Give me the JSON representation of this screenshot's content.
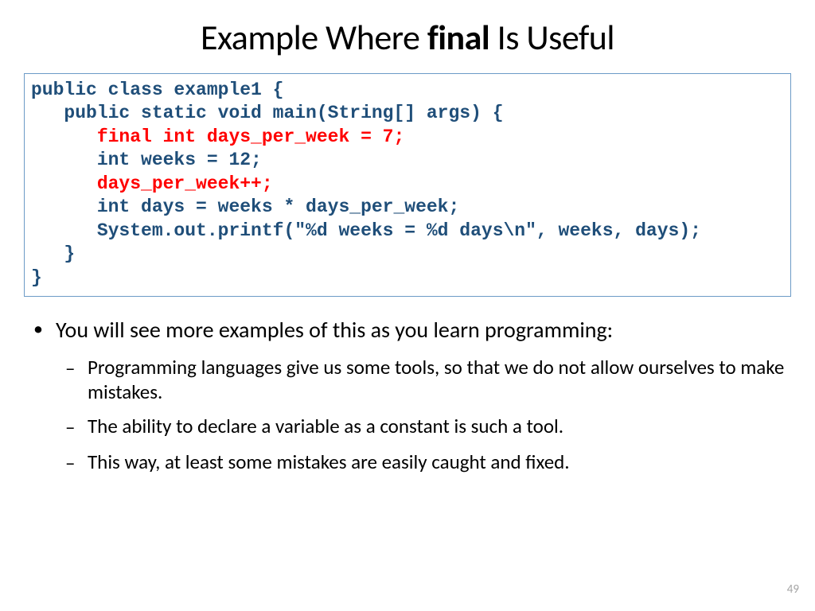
{
  "title": {
    "pre": "Example Where ",
    "bold": "final",
    "post": " Is Useful"
  },
  "code": {
    "l1": "public class example1 {",
    "l2": "   public static void main(String[] args) {",
    "l3": "      final int days_per_week = 7;",
    "l4": "      int weeks = 12;",
    "l5": "      days_per_week++;",
    "l6": "      int days = weeks * days_per_week;",
    "l7": "      System.out.printf(\"%d weeks = %d days\\n\", weeks, days);",
    "l8": "   }",
    "l9": "}"
  },
  "bullets": {
    "main": "You will see more examples of this as you learn programming:",
    "sub1": "Programming languages give us some tools, so that we do not allow ourselves to make mistakes.",
    "sub2": "The ability to declare a variable as a constant is such a tool.",
    "sub3": "This way, at least some mistakes are easily caught and fixed."
  },
  "pagenum": "49"
}
